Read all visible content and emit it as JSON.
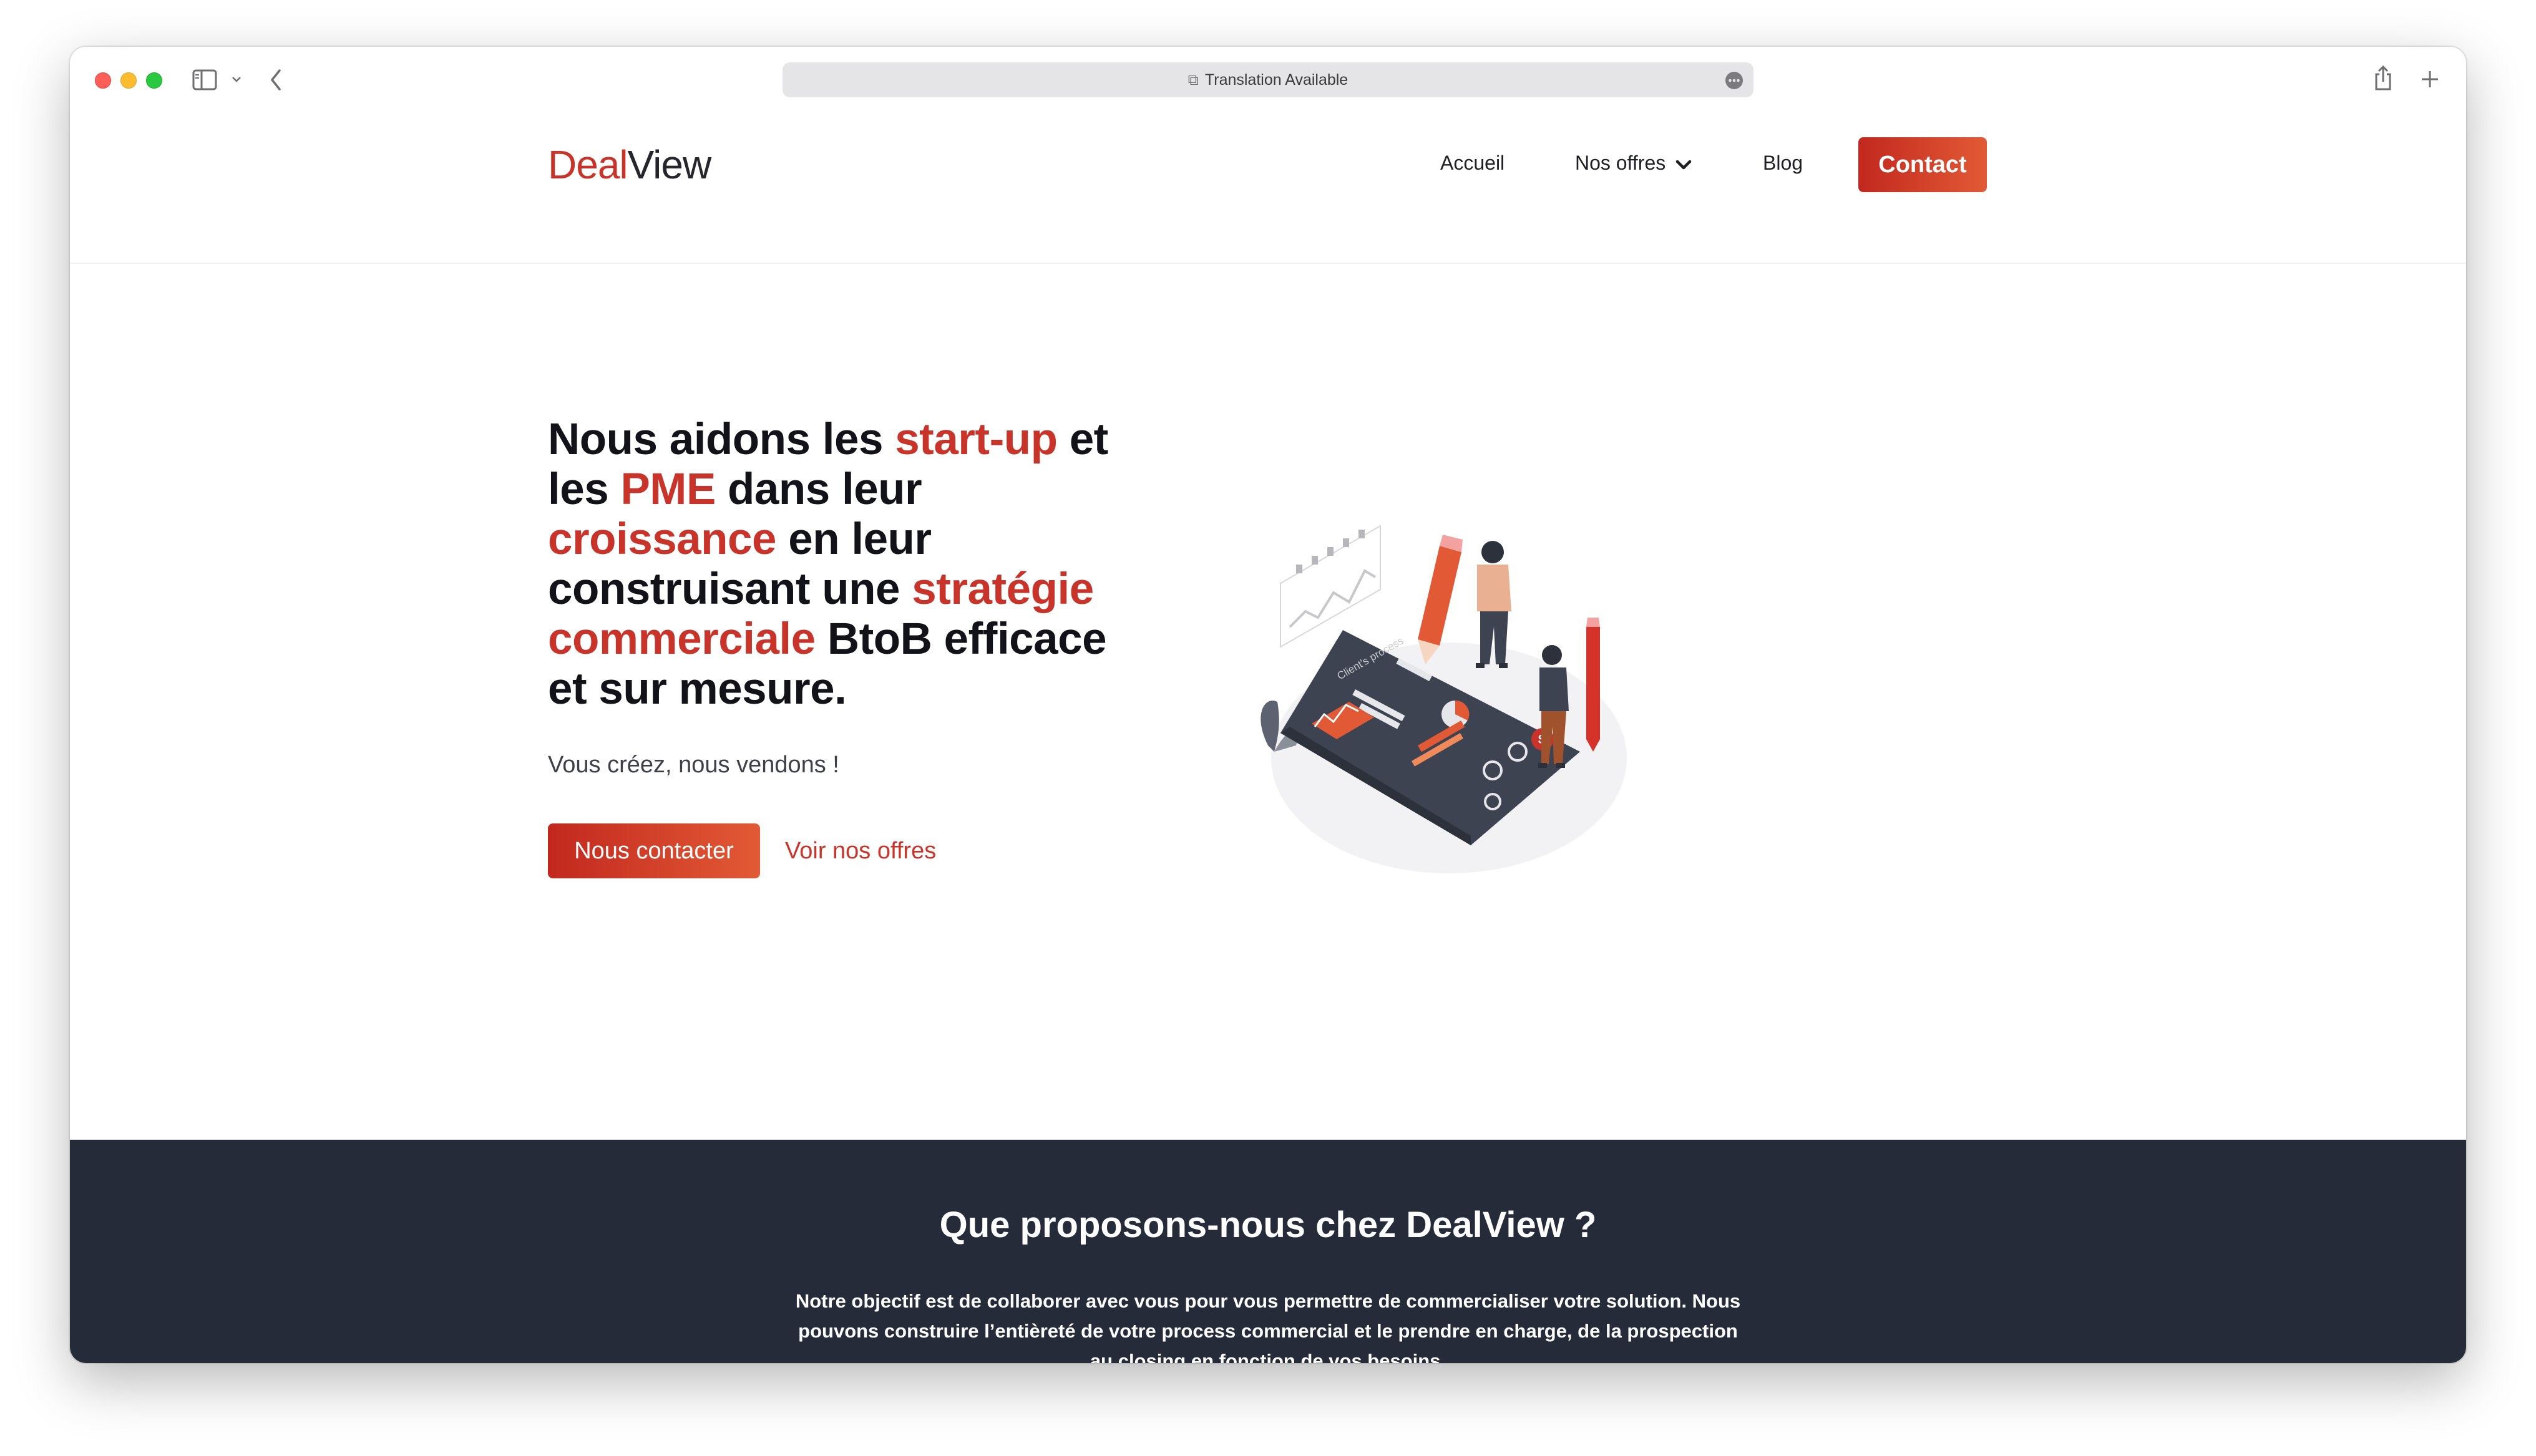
{
  "browser": {
    "address_text": "Translation Available"
  },
  "site": {
    "logo_part1": "Deal",
    "logo_part2": "View",
    "nav": {
      "accueil": "Accueil",
      "offres": "Nos offres",
      "blog": "Blog",
      "contact": "Contact"
    }
  },
  "hero": {
    "title": {
      "t1": "Nous aidons les ",
      "h1": "start-up",
      "t2": " et les ",
      "h2": "PME",
      "t3": " dans leur ",
      "h3": "croissance",
      "t4": " en leur construisant une ",
      "h4": "stratégie commerciale",
      "t5": " BtoB efficace et sur mesure."
    },
    "subtitle": "Vous créez, nous vendons !",
    "primary_button": "Nous contacter",
    "secondary_link": "Voir nos offres",
    "illustration_label": "Client's process"
  },
  "section": {
    "title": "Que proposons-nous chez DealView ?",
    "text": "Notre objectif est de collaborer avec vous pour vous permettre de commercialiser votre solution. Nous pouvons construire l’entièreté de votre process commercial et le prendre en charge, de la prospection au closing en fonction de vos besoins."
  },
  "colors": {
    "brand_red": "#c9342a",
    "brand_orange": "#e25a35",
    "dark_section": "#252b38"
  }
}
